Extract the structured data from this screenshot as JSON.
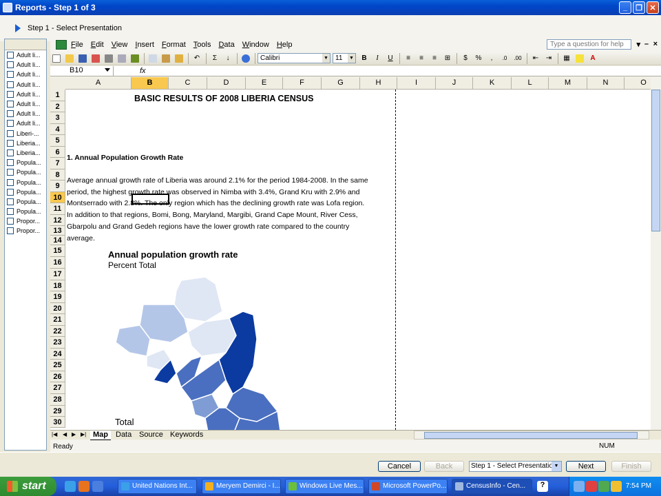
{
  "window": {
    "title": "Reports - Step 1 of 3"
  },
  "step_header": {
    "label": "Step 1 - Select Presentation"
  },
  "left_panel": {
    "items": [
      "Adult li...",
      "Adult li...",
      "Adult li...",
      "Adult li...",
      "Adult li...",
      "Adult li...",
      "Adult li...",
      "Adult li...",
      "Liberi-...",
      "Liberia...",
      "Liberia...",
      "Popula...",
      "Popula...",
      "Popula...",
      "Popula...",
      "Popula...",
      "Popula...",
      "Propor...",
      "Propor..."
    ]
  },
  "menu": {
    "items": [
      "File",
      "Edit",
      "View",
      "Insert",
      "Format",
      "Tools",
      "Data",
      "Window",
      "Help"
    ],
    "ask_placeholder": "Type a question for help"
  },
  "toolbar": {
    "font": "Calibri",
    "size": "11"
  },
  "formula_bar": {
    "name_box": "B10",
    "fx": "fx"
  },
  "grid": {
    "columns": [
      "A",
      "B",
      "C",
      "D",
      "E",
      "F",
      "G",
      "H",
      "I",
      "J",
      "K",
      "L",
      "M",
      "N",
      "O"
    ],
    "selected_column": "B",
    "rows": [
      "1",
      "2",
      "3",
      "4",
      "5",
      "6",
      "7",
      "8",
      "9",
      "10",
      "11",
      "12",
      "13",
      "14",
      "15",
      "16",
      "17",
      "18",
      "19",
      "20",
      "21",
      "22",
      "23",
      "24",
      "25",
      "26",
      "27",
      "28",
      "29",
      "30"
    ],
    "selected_row": "10"
  },
  "sheet_content": {
    "title": "BASIC RESULTS OF 2008 LIBERIA CENSUS",
    "section": "1. Annual Population Growth Rate",
    "paragraph_lines": [
      " Average annual growth rate of Liberia was around 2.1% for the period 1984-2008. In the same",
      "period, the highest growth rate was observed in Nimba with 3.4%,  Grand Kru with 2.9% and",
      "Montserrado with 2.8%. The only region which has the declining growth rate was Lofa region.",
      "In addition to that regions, Bomi, Bong, Maryland, Margibi, Grand Cape Mount, River Cess,",
      "Gbarpolu and Grand Gedeh regions have the lower growth rate compared to the country",
      "average."
    ],
    "map_title": "Annual population growth rate",
    "map_subtitle": "Percent Total",
    "map_legend_title": "Total",
    "map_colors": {
      "darkest": "#0b3aa0",
      "dark": "#4a6fc0",
      "mid": "#7f9cd4",
      "light": "#b4c6e8",
      "lightest": "#dfe6f4"
    }
  },
  "sheet_tabs": [
    "Map",
    "Data",
    "Source",
    "Keywords"
  ],
  "active_tab": "Map",
  "status": {
    "text": "Ready",
    "num": "NUM"
  },
  "wizard_buttons": {
    "cancel": "Cancel",
    "back": "Back",
    "step_select": "Step 1 - Select Presentation",
    "next": "Next",
    "finish": "Finish"
  },
  "taskbar": {
    "start": "start",
    "tasks": [
      "United Nations Int...",
      "Meryem Demirci - I...",
      "Windows Live Mes...",
      "Microsoft PowerPo...",
      "CensusInfo - Cen..."
    ],
    "clock": "7:54 PM"
  }
}
